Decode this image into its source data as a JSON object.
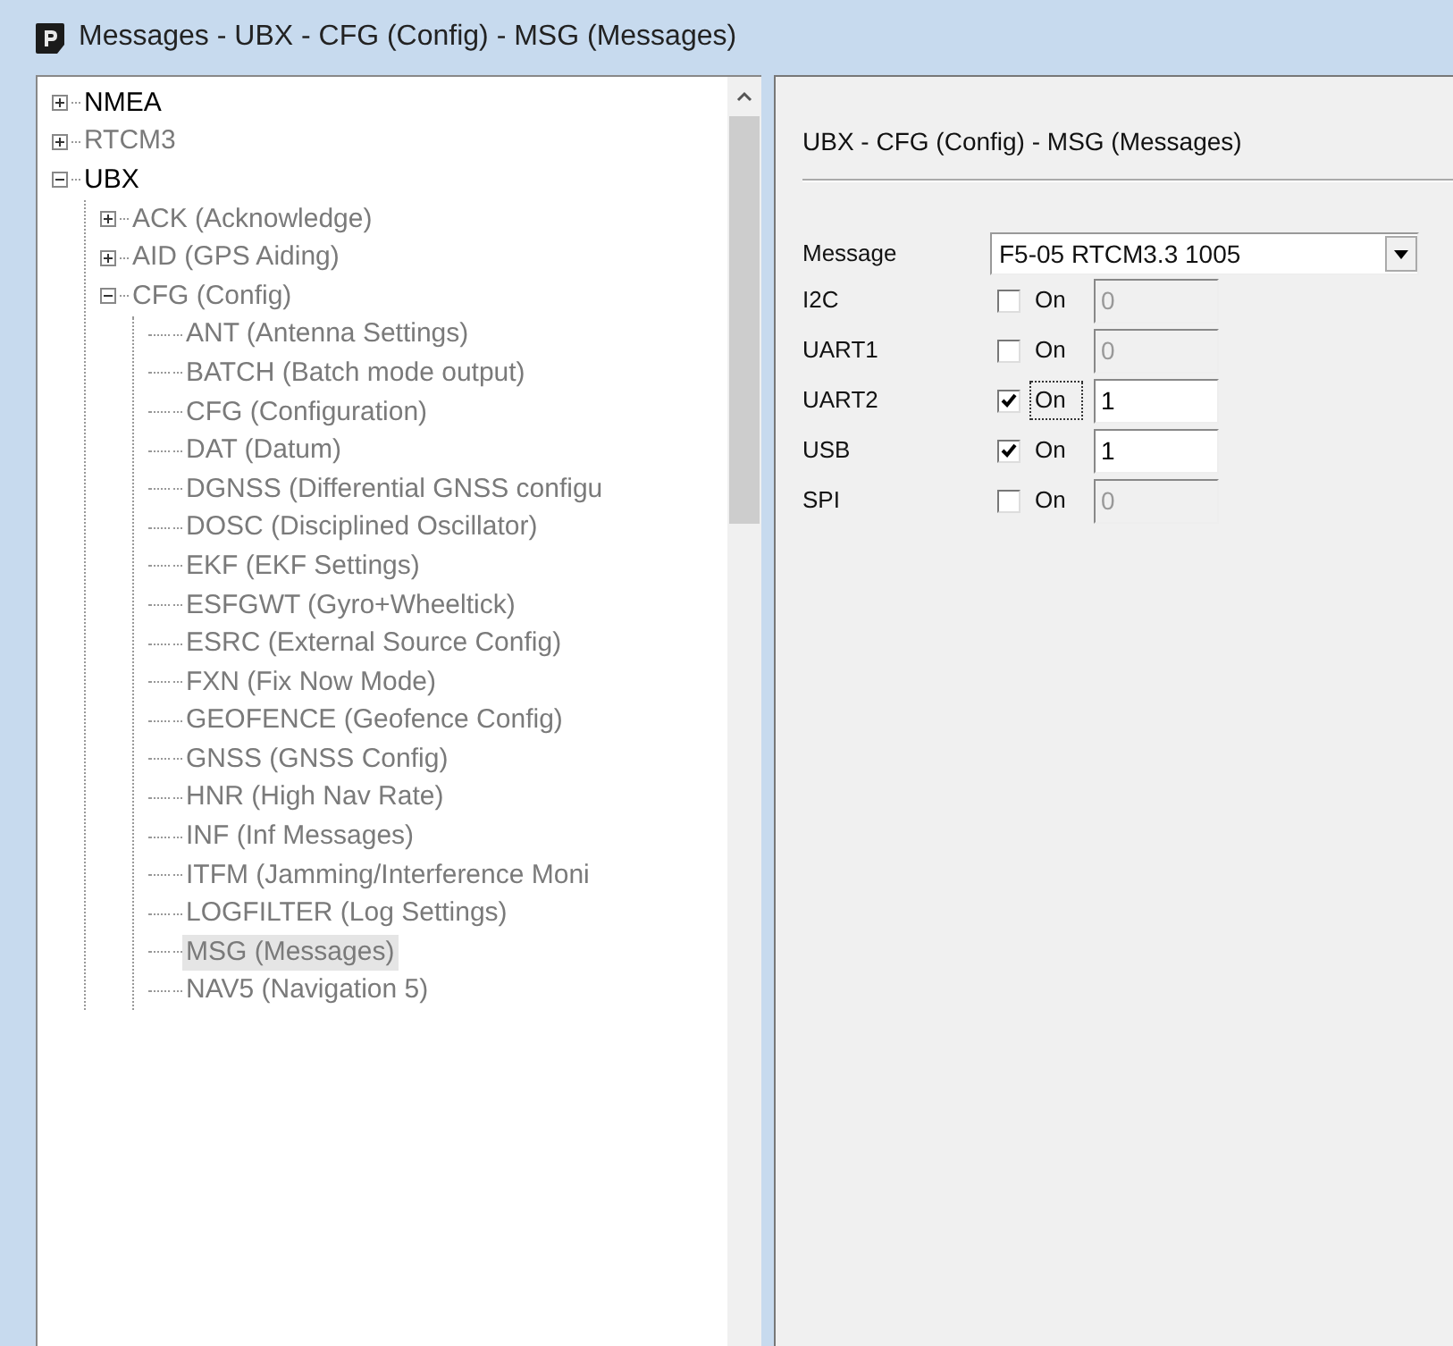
{
  "window": {
    "title": "Messages - UBX - CFG (Config) - MSG (Messages)"
  },
  "tree": [
    {
      "label": "NMEA",
      "dimmed": false,
      "expanded": false,
      "selected": false
    },
    {
      "label": "RTCM3",
      "dimmed": true,
      "expanded": false,
      "selected": false
    },
    {
      "label": "UBX",
      "dimmed": false,
      "expanded": true,
      "selected": false,
      "children": [
        {
          "label": "ACK (Acknowledge)",
          "dimmed": true,
          "expanded": false,
          "selected": false
        },
        {
          "label": "AID (GPS Aiding)",
          "dimmed": true,
          "expanded": false,
          "selected": false
        },
        {
          "label": "CFG (Config)",
          "dimmed": true,
          "expanded": true,
          "selected": false,
          "children": [
            {
              "label": "ANT (Antenna Settings)",
              "dimmed": true,
              "selected": false
            },
            {
              "label": "BATCH (Batch mode output)",
              "dimmed": true,
              "selected": false
            },
            {
              "label": "CFG (Configuration)",
              "dimmed": true,
              "selected": false
            },
            {
              "label": "DAT (Datum)",
              "dimmed": true,
              "selected": false
            },
            {
              "label": "DGNSS (Differential GNSS configu",
              "dimmed": true,
              "selected": false
            },
            {
              "label": "DOSC (Disciplined Oscillator)",
              "dimmed": true,
              "selected": false
            },
            {
              "label": "EKF (EKF Settings)",
              "dimmed": true,
              "selected": false
            },
            {
              "label": "ESFGWT (Gyro+Wheeltick)",
              "dimmed": true,
              "selected": false
            },
            {
              "label": "ESRC (External Source Config)",
              "dimmed": true,
              "selected": false
            },
            {
              "label": "FXN (Fix Now Mode)",
              "dimmed": true,
              "selected": false
            },
            {
              "label": "GEOFENCE (Geofence Config)",
              "dimmed": true,
              "selected": false
            },
            {
              "label": "GNSS (GNSS Config)",
              "dimmed": true,
              "selected": false
            },
            {
              "label": "HNR (High Nav Rate)",
              "dimmed": true,
              "selected": false
            },
            {
              "label": "INF (Inf Messages)",
              "dimmed": true,
              "selected": false
            },
            {
              "label": "ITFM (Jamming/Interference Moni",
              "dimmed": true,
              "selected": false
            },
            {
              "label": "LOGFILTER (Log Settings)",
              "dimmed": true,
              "selected": false
            },
            {
              "label": "MSG (Messages)",
              "dimmed": true,
              "selected": true
            },
            {
              "label": "NAV5 (Navigation 5)",
              "dimmed": true,
              "selected": false
            }
          ]
        }
      ]
    }
  ],
  "panel": {
    "heading": "UBX - CFG (Config) - MSG (Messages)",
    "message": {
      "label": "Message",
      "value": "F5-05 RTCM3.3 1005"
    },
    "ports": [
      {
        "name": "I2C",
        "on_label": "On",
        "checked": false,
        "focused": false,
        "value": "0"
      },
      {
        "name": "UART1",
        "on_label": "On",
        "checked": false,
        "focused": false,
        "value": "0"
      },
      {
        "name": "UART2",
        "on_label": "On",
        "checked": true,
        "focused": true,
        "value": "1"
      },
      {
        "name": "USB",
        "on_label": "On",
        "checked": true,
        "focused": false,
        "value": "1"
      },
      {
        "name": "SPI",
        "on_label": "On",
        "checked": false,
        "focused": false,
        "value": "0"
      }
    ]
  }
}
